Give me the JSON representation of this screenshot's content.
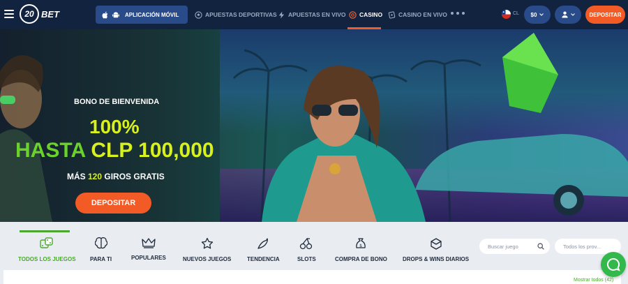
{
  "header": {
    "logo_number": "20",
    "logo_text": "BET",
    "app_button_label": "APLICACIÓN MÓVIL",
    "nav": [
      {
        "label": "APUESTAS DEPORTIVAS",
        "icon": "soccer-ball-icon",
        "active": false
      },
      {
        "label": "APUESTAS EN VIVO",
        "icon": "live-bolt-icon",
        "active": false
      },
      {
        "label": "CASINO",
        "icon": "casino-chip-icon",
        "active": true
      },
      {
        "label": "CASINO EN VIVO",
        "icon": "live-casino-icon",
        "active": false
      }
    ],
    "more_icon": "more-dots-icon",
    "country_code": "CL",
    "balance": "$0",
    "deposit_label": "DEPOSITAR"
  },
  "hero": {
    "welcome": "BONO DE BIENVENIDA",
    "percent": "100%",
    "up_to": "HASTA",
    "amount": "CLP 100,000",
    "spins_pre": "MÁS ",
    "spins_num": "120",
    "spins_post": " GIROS GRATIS",
    "cta": "DEPOSITAR"
  },
  "categories": [
    {
      "label": "TODOS LOS JUEGOS",
      "icon": "dice-icon",
      "active": true
    },
    {
      "label": "PARA TI",
      "icon": "brain-icon",
      "active": false
    },
    {
      "label": "POPULARES",
      "icon": "crown-icon",
      "active": false
    },
    {
      "label": "NUEVOS JUEGOS",
      "icon": "star-icon",
      "active": false
    },
    {
      "label": "TENDENCIA",
      "icon": "chili-icon",
      "active": false
    },
    {
      "label": "SLOTS",
      "icon": "cherries-icon",
      "active": false
    },
    {
      "label": "COMPRA DE BONO",
      "icon": "money-bag-icon",
      "active": false
    },
    {
      "label": "DROPS & WINS DIARIOS",
      "icon": "drops-wins-icon",
      "active": false
    }
  ],
  "search": {
    "placeholder": "Buscar juego"
  },
  "providers": {
    "placeholder": "Todos los prov..."
  },
  "show_all": "Mostrar todos (42)",
  "colors": {
    "header_bg": "#12233f",
    "accent_orange": "#f25a26",
    "accent_green": "#4aa82e",
    "hero_yellow": "#d8f01e"
  }
}
